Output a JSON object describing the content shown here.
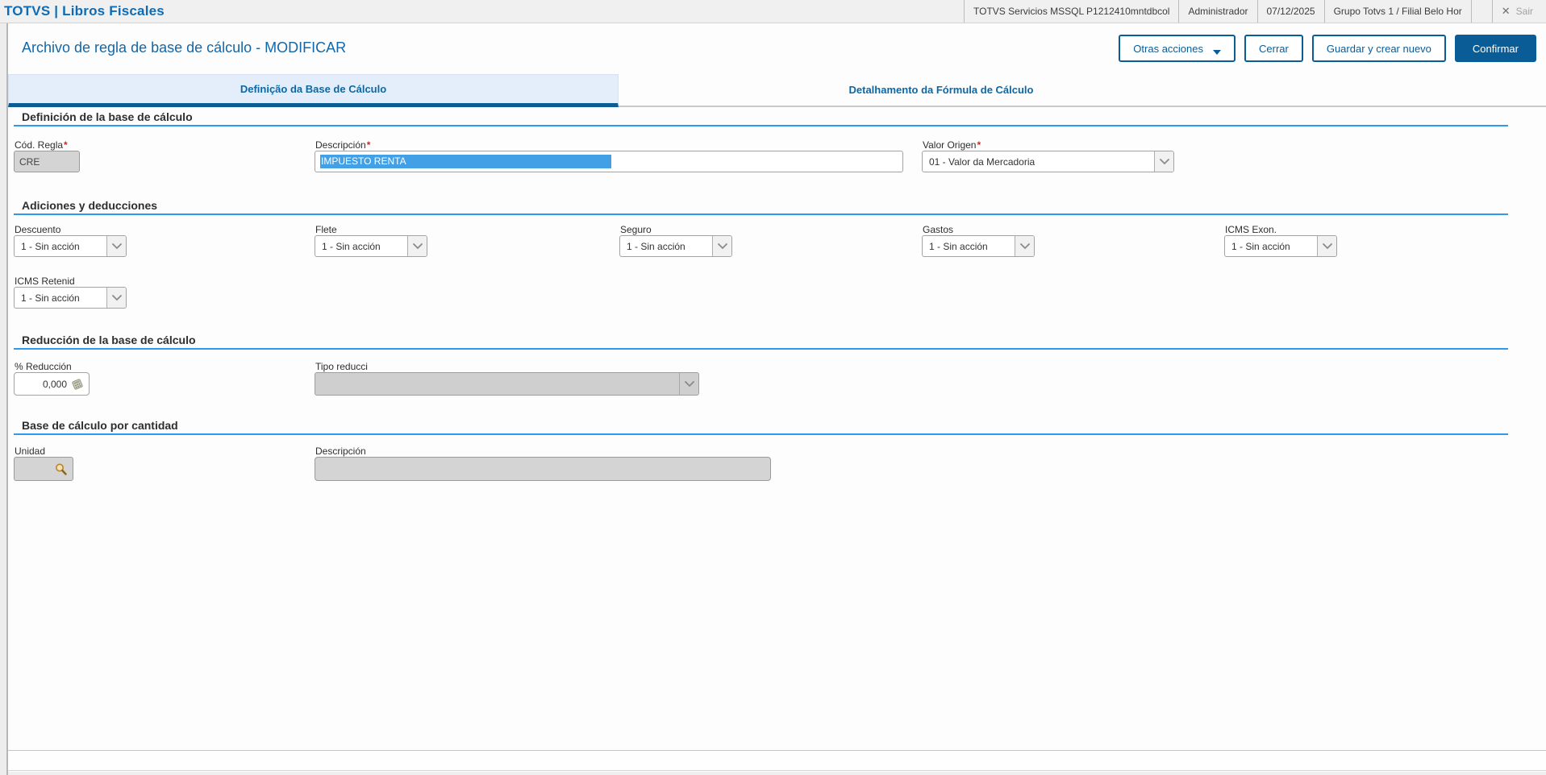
{
  "topbar": {
    "brand": "TOTVS | Libros Fiscales",
    "items": [
      "TOTVS Servicios MSSQL P1212410mntdbcol",
      "Administrador",
      "07/12/2025",
      "Grupo Totvs 1 / Filial Belo Hor"
    ],
    "exit_label": "Sair",
    "exit_icon": "✕"
  },
  "header": {
    "title": "Archivo de regla de base de cálculo - MODIFICAR",
    "buttons": {
      "otras": "Otras acciones",
      "cerrar": "Cerrar",
      "guardar": "Guardar y crear nuevo",
      "confirmar": "Confirmar"
    }
  },
  "tabs": [
    {
      "label": "Definição da Base de Cálculo",
      "active": true
    },
    {
      "label": "Detalhamento da Fórmula de Cálculo",
      "active": false
    }
  ],
  "ui": {
    "required_mark": "*"
  },
  "sections": {
    "definicion": {
      "title": "Definición de la base de cálculo",
      "fields": {
        "cod_regla": {
          "label": "Cód. Regla",
          "required": true,
          "value": "CRE",
          "disabled": true
        },
        "descripcion": {
          "label": "Descripción",
          "required": true,
          "value": "IMPUESTO RENTA",
          "selected": true
        },
        "valor_origen": {
          "label": "Valor Origen",
          "required": true,
          "value": "01 - Valor da Mercadoria"
        }
      }
    },
    "adiciones": {
      "title": "Adiciones y deducciones",
      "fields": [
        {
          "label": "Descuento",
          "value": "1 - Sin acción"
        },
        {
          "label": "Flete",
          "value": "1 - Sin acción"
        },
        {
          "label": "Seguro",
          "value": "1 - Sin acción"
        },
        {
          "label": "Gastos",
          "value": "1 - Sin acción"
        },
        {
          "label": "ICMS Exon.",
          "value": "1 - Sin acción"
        },
        {
          "label": "ICMS Retenid",
          "value": "1 - Sin acción"
        }
      ]
    },
    "reduccion": {
      "title": "Reducción de la base de cálculo",
      "fields": {
        "pct_reduccion": {
          "label": "% Reducción",
          "value": "0,000"
        },
        "tipo_reducci": {
          "label": "Tipo reducci",
          "value": "",
          "disabled": true
        }
      }
    },
    "cantidad": {
      "title": "Base de cálculo por cantidad",
      "fields": {
        "unidad": {
          "label": "Unidad",
          "value": ""
        },
        "descripcion": {
          "label": "Descripción",
          "value": "",
          "disabled": true
        }
      }
    }
  },
  "colors": {
    "brand_blue": "#0d6cb5",
    "button_blue": "#0a5c96",
    "section_line_blue": "#2b9af3",
    "tab_active_bg": "#e4eefa",
    "selection_blue": "#41a0e6",
    "disabled_gray": "#d4d4d4"
  }
}
